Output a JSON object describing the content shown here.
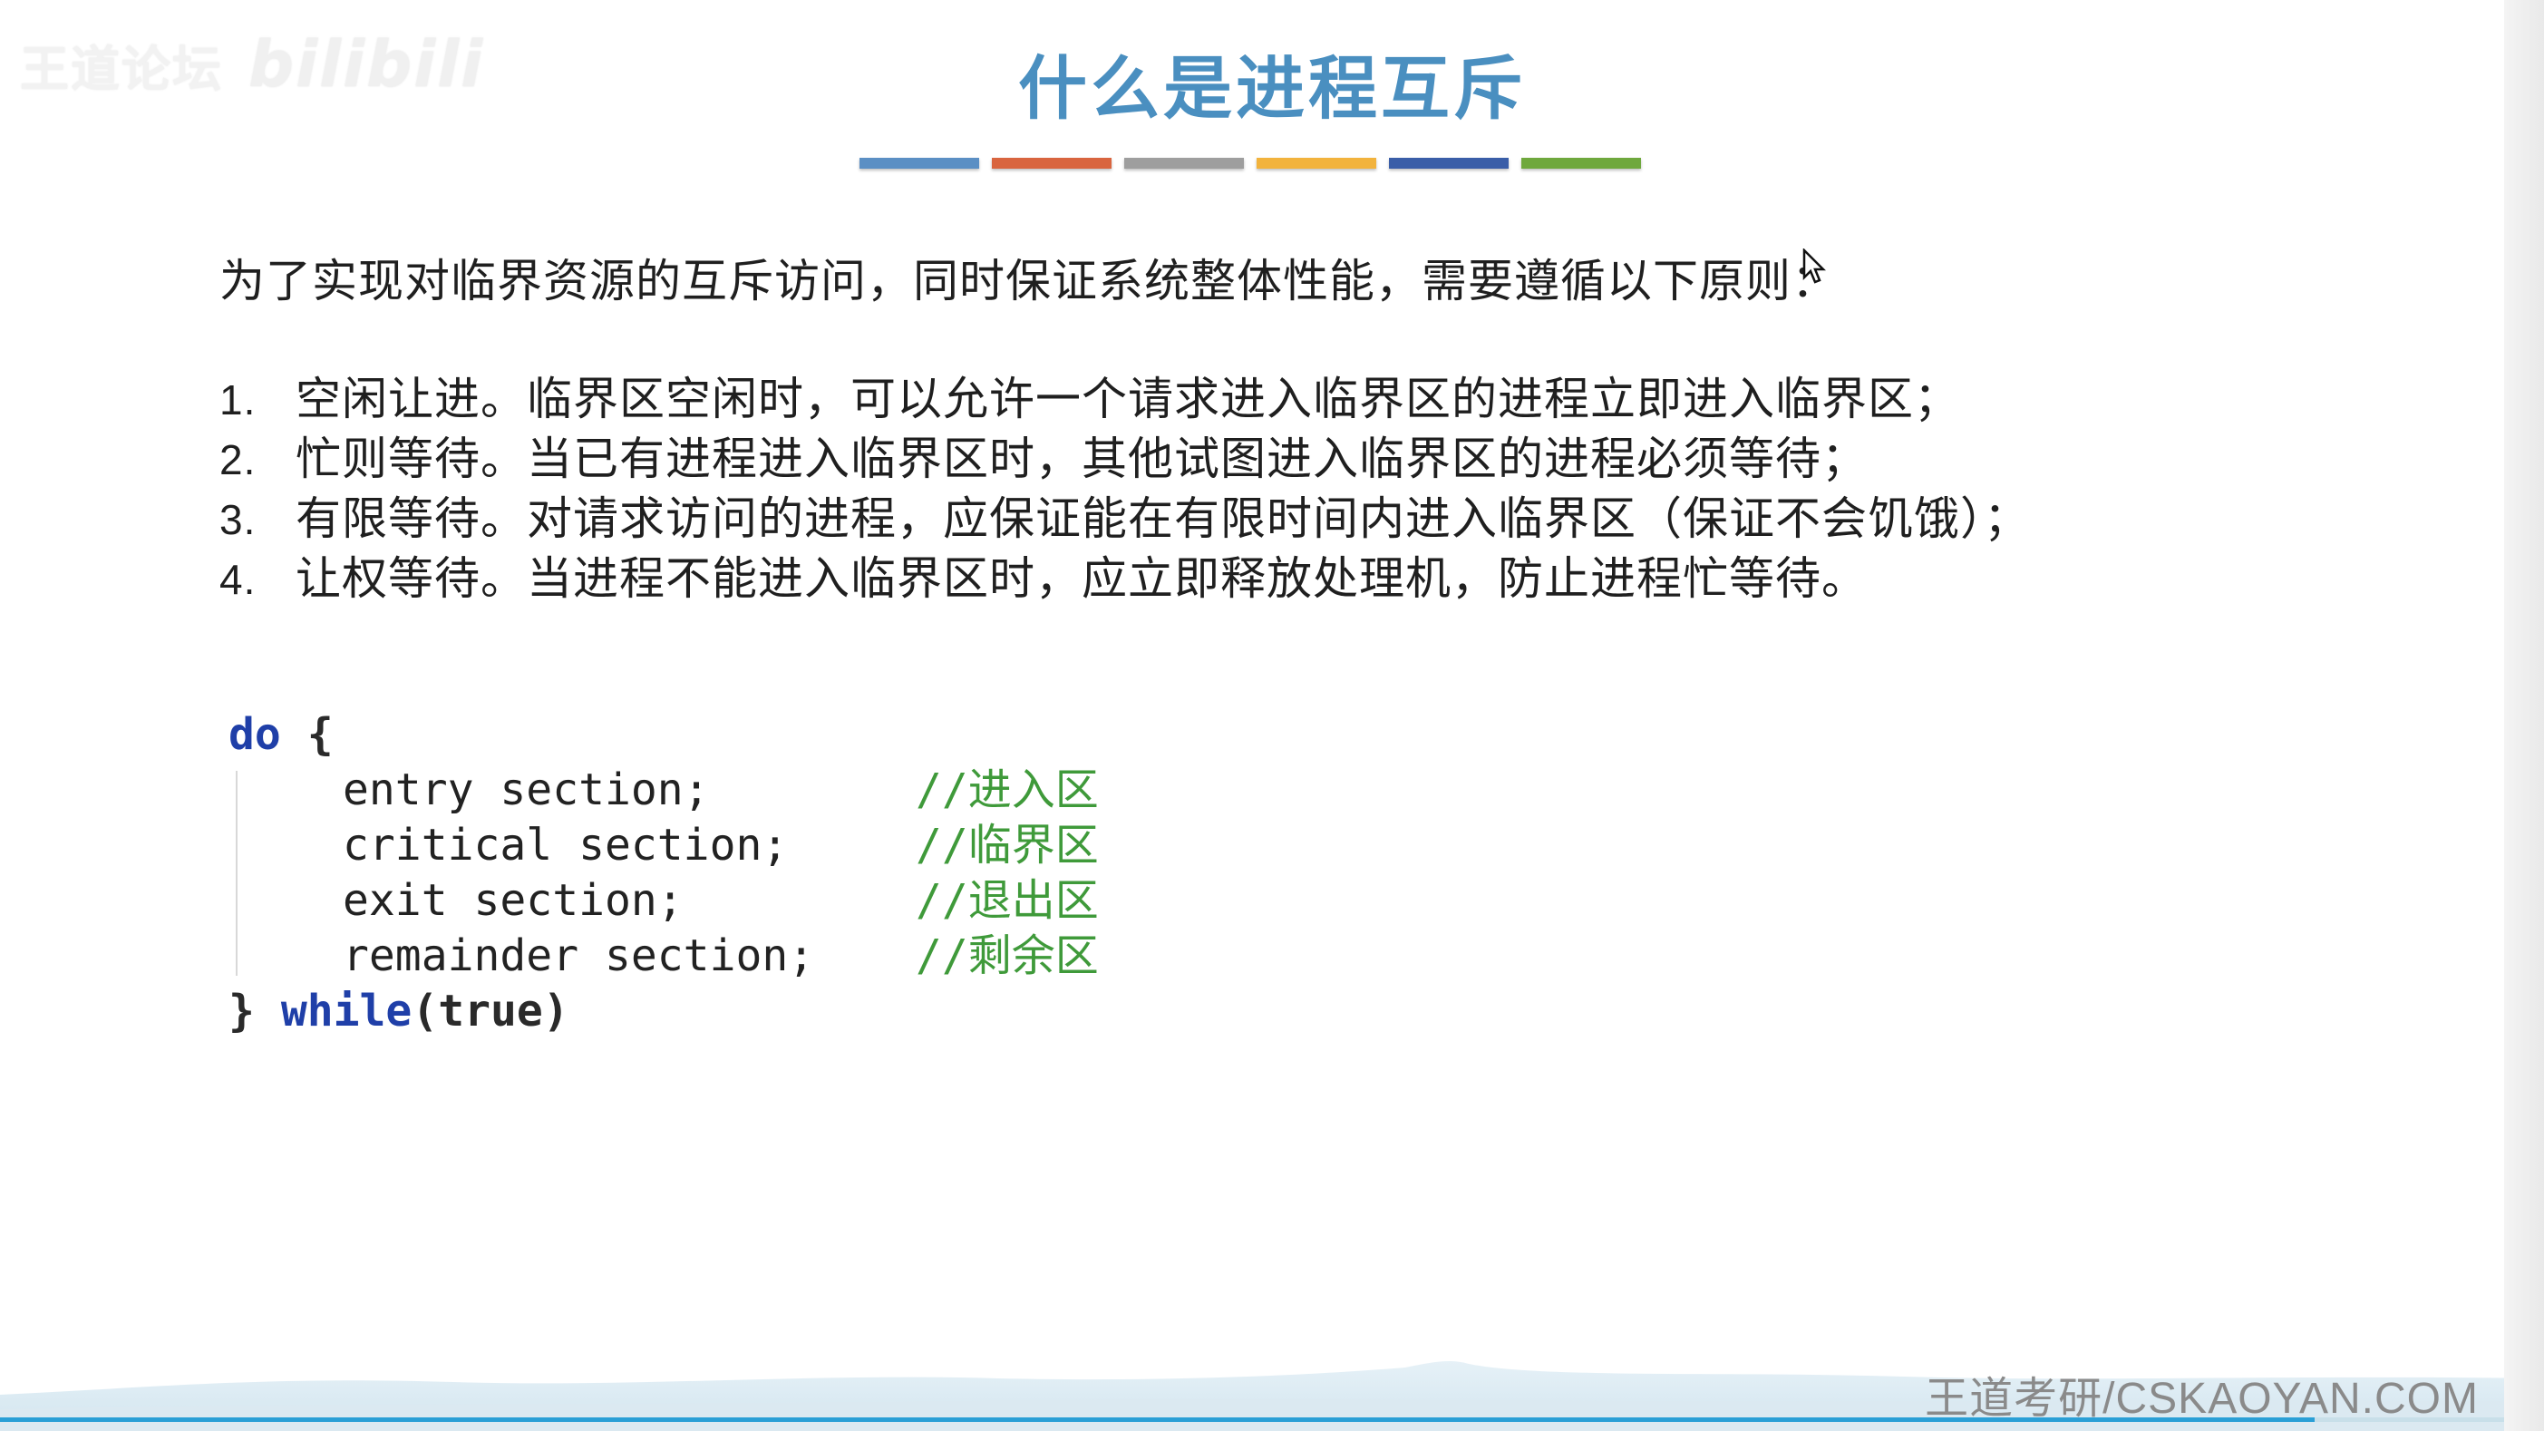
{
  "watermark": {
    "left_text": "王道论坛",
    "right_text": "bilibili"
  },
  "slide": {
    "title": "什么是进程互斥",
    "color_bar": [
      "#5b8fc4",
      "#d9653f",
      "#9e9e9e",
      "#f2b33d",
      "#3a5ea8",
      "#6fa83d"
    ],
    "intro": "为了实现对临界资源的互斥访问，同时保证系统整体性能，需要遵循以下原则：",
    "principles": [
      {
        "num": "1.",
        "text": "空闲让进。临界区空闲时，可以允许一个请求进入临界区的进程立即进入临界区；"
      },
      {
        "num": "2.",
        "text": "忙则等待。当已有进程进入临界区时，其他试图进入临界区的进程必须等待；"
      },
      {
        "num": "3.",
        "text": "有限等待。对请求访问的进程，应保证能在有限时间内进入临界区（保证不会饥饿）；"
      },
      {
        "num": "4.",
        "text": "让权等待。当进程不能进入临界区时，应立即释放处理机，防止进程忙等待。"
      }
    ],
    "code": {
      "open_kw": "do",
      "open_brace": "{",
      "lines": [
        {
          "stmt": "entry section;",
          "comment": "//进入区"
        },
        {
          "stmt": "critical section;",
          "comment": "//临界区"
        },
        {
          "stmt": "exit section;",
          "comment": "//退出区"
        },
        {
          "stmt": "remainder section;",
          "comment": "//剩余区"
        }
      ],
      "close_brace": "}",
      "close_kw": "while",
      "close_cond": "(true)"
    }
  },
  "footer": {
    "brand": "王道考研/CSKAOYAN.COM"
  },
  "video": {
    "progress_fraction": 0.91
  }
}
